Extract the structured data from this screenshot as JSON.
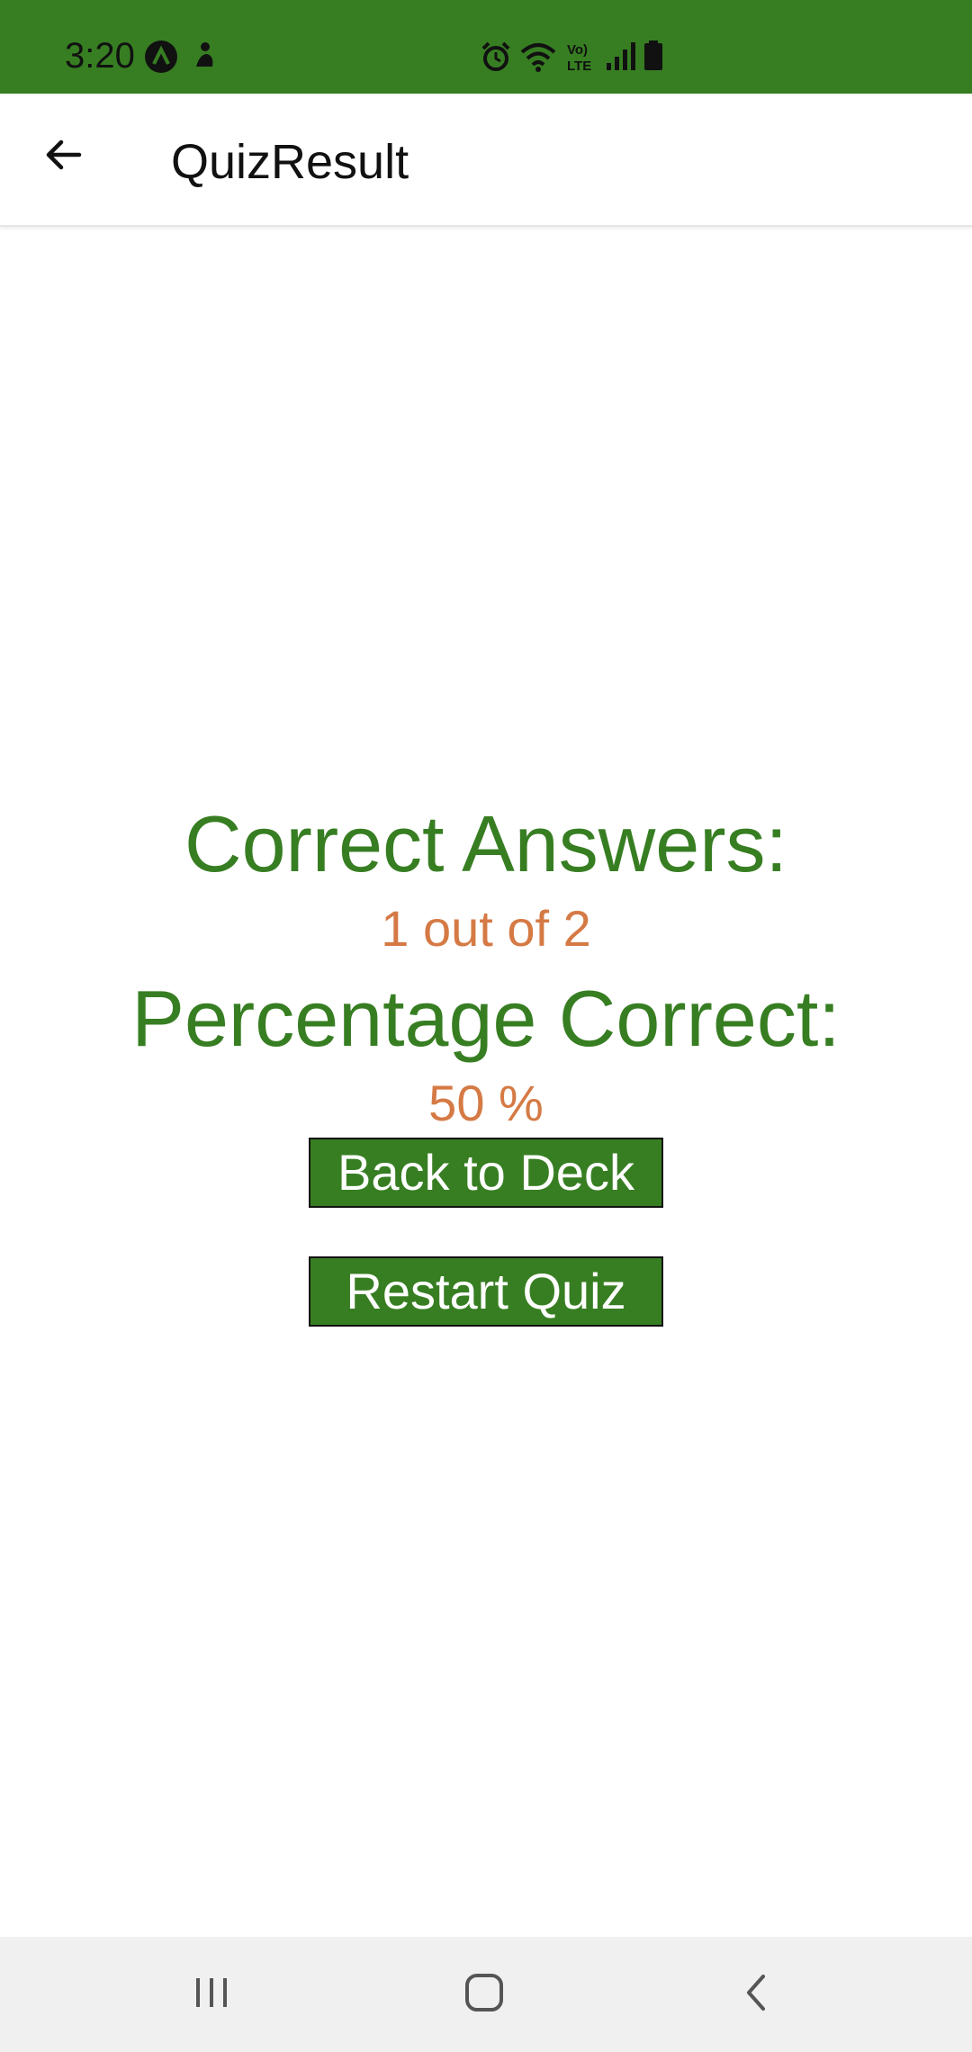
{
  "status_bar": {
    "time": "3:20",
    "background": "#377e22",
    "left_icons": [
      "app-badge-icon",
      "accessibility-icon"
    ],
    "right_icons": [
      "alarm-icon",
      "wifi-icon",
      "volte-icon",
      "signal-icon",
      "battery-icon"
    ]
  },
  "app_bar": {
    "title": "QuizResult",
    "back_icon": "arrow-left-icon"
  },
  "result": {
    "correct_label": "Correct Answers:",
    "correct_value": "1 out of 2",
    "percentage_label": "Percentage Correct:",
    "percentage_value": "50 %",
    "label_color": "#377e22",
    "value_color": "#d57a45"
  },
  "actions": {
    "back_to_deck": "Back to Deck",
    "restart_quiz": "Restart Quiz",
    "button_color": "#377e22"
  },
  "nav_bar": {
    "items": [
      "recent-apps-icon",
      "home-icon",
      "back-icon"
    ]
  }
}
